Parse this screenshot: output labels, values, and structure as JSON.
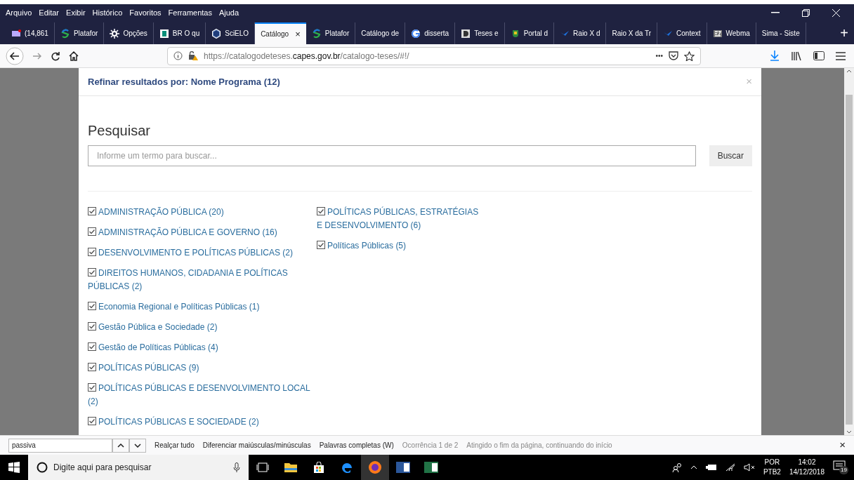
{
  "menu": [
    "Arquivo",
    "Editar",
    "Exibir",
    "Histórico",
    "Favoritos",
    "Ferramentas",
    "Ajuda"
  ],
  "tabs": [
    {
      "label": "(14,861",
      "selected": false
    },
    {
      "label": "Platafor",
      "selected": false
    },
    {
      "label": "Opções",
      "selected": false
    },
    {
      "label": "BR O qu",
      "selected": false
    },
    {
      "label": "SciELO",
      "selected": false
    },
    {
      "label": "Catálogo",
      "selected": true
    },
    {
      "label": "Platafor",
      "selected": false
    },
    {
      "label": "Catálogo de",
      "selected": false
    },
    {
      "label": "disserta",
      "selected": false
    },
    {
      "label": "Teses e",
      "selected": false
    },
    {
      "label": "Portal d",
      "selected": false
    },
    {
      "label": "Raio X d",
      "selected": false
    },
    {
      "label": "Raio X da Tr",
      "selected": false
    },
    {
      "label": "Context",
      "selected": false
    },
    {
      "label": "Webma",
      "selected": false
    },
    {
      "label": "Sima - Siste",
      "selected": false
    }
  ],
  "new_tab": "+",
  "tab_close": "×",
  "url": {
    "prefix": "https://catalogodeteses.",
    "domain": "capes.gov.br",
    "path": "/catalogo-teses/#!/"
  },
  "url_more": "•••",
  "modal": {
    "title": "Refinar resultados por: Nome Programa (12)",
    "close": "×",
    "heading": "Pesquisar",
    "search_placeholder": "Informe um termo para buscar...",
    "search_button": "Buscar",
    "columns": [
      [
        {
          "label": "ADMINISTRAÇÃO PÚBLICA (20)",
          "checked": true
        },
        {
          "label": "ADMINISTRAÇÃO PÚBLICA E GOVERNO (16)",
          "checked": true
        },
        {
          "label": "DESENVOLVIMENTO E POLÍTICAS PÚBLICAS (2)",
          "checked": true
        },
        {
          "label": "DIREITOS HUMANOS, CIDADANIA E POLÍTICAS PÚBLICAS (2)",
          "checked": true
        },
        {
          "label": "Economia Regional e Políticas Públicas (1)",
          "checked": true
        },
        {
          "label": "Gestão Pública e Sociedade (2)",
          "checked": true
        },
        {
          "label": "Gestão de Políticas Públicas (4)",
          "checked": true
        },
        {
          "label": "POLÍTICAS PÚBLICAS (9)",
          "checked": true
        },
        {
          "label": "POLÍTICAS PÚBLICAS E DESENVOLVIMENTO LOCAL (2)",
          "checked": true
        },
        {
          "label": "POLÍTICAS PÚBLICAS E SOCIEDADE (2)",
          "checked": true
        }
      ],
      [
        {
          "label": "POLÍTICAS PÚBLICAS, ESTRATÉGIAS E DESENVOLVIMENTO (6)",
          "checked": true
        },
        {
          "label": "Políticas Públicas (5)",
          "checked": true
        }
      ]
    ]
  },
  "find_bar": {
    "value": "passiva",
    "options": [
      "Realçar tudo",
      "Diferenciar maiúsculas/minúsculas",
      "Palavras completas (W)"
    ],
    "status": "Ocorrência 1 de 2",
    "message": "Atingido o fim da página, continuando do início",
    "close": "×"
  },
  "taskbar": {
    "search_placeholder": "Digite aqui para pesquisar",
    "language": "POR",
    "layout": "PTB2",
    "time": "14:02",
    "date": "14/12/2018",
    "notifications": "19"
  }
}
